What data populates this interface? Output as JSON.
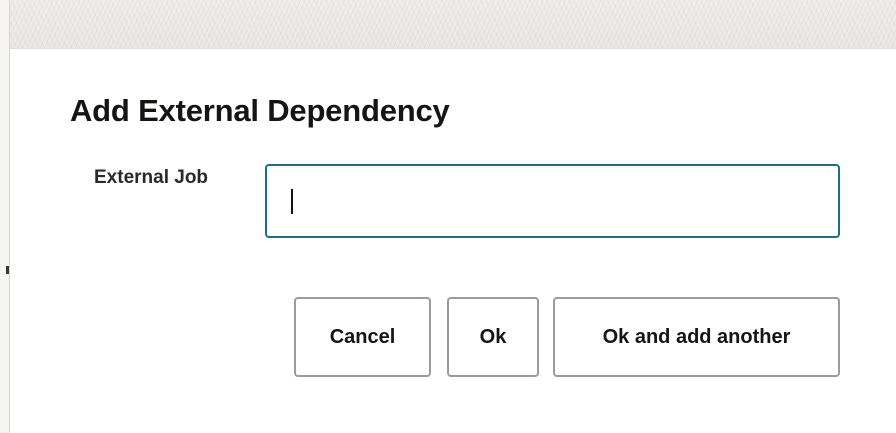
{
  "dialog": {
    "title": "Add External Dependency",
    "field": {
      "label": "External Job",
      "value": "",
      "placeholder": ""
    },
    "buttons": {
      "cancel": "Cancel",
      "ok": "Ok",
      "ok_and_add": "Ok and add another"
    }
  },
  "colors": {
    "focus_border": "#1f6c8a",
    "button_border": "#9e9a96",
    "text": "#161513",
    "dialog_bg": "#ffffff",
    "backdrop": "#f1efed"
  }
}
